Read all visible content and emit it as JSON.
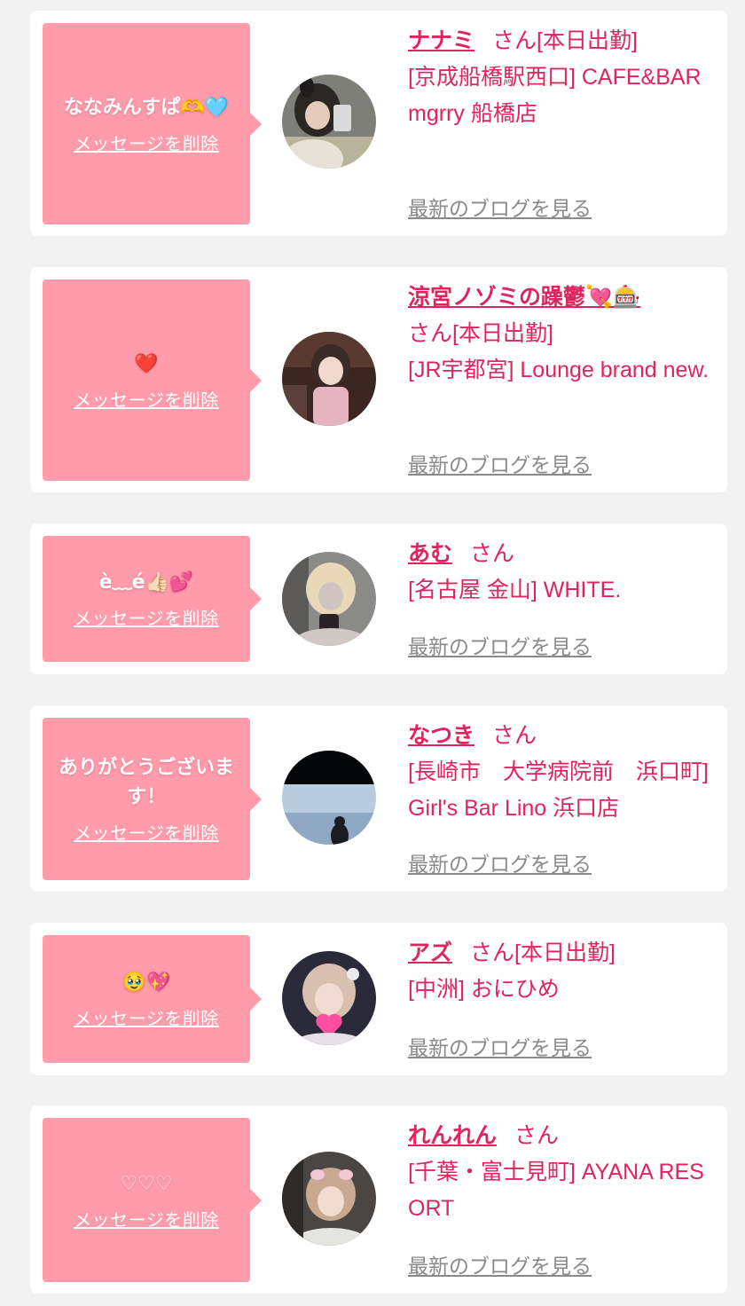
{
  "messages": [
    {
      "message": "ななみんすぱ🫶🩵",
      "delete_label": "メッセージを削除",
      "name": "ナナミ",
      "san": "さん",
      "status": "[本日出勤]",
      "shop": "[京成船橋駅西口] CAFE&BAR mgrry 船橋店",
      "blog_label": "最新のブログを見る"
    },
    {
      "message": "❤️",
      "delete_label": "メッセージを削除",
      "name": "涼宮ノゾミの躁鬱💘🎰",
      "san": "さん",
      "status": "[本日出勤]",
      "shop": "[JR宇都宮] Lounge brand new.",
      "blog_label": "最新のブログを見る"
    },
    {
      "message": "è﹏é👍🏻💕",
      "delete_label": "メッセージを削除",
      "name": "あむ",
      "san": "さん",
      "status": "",
      "shop": "[名古屋 金山] WHITE.",
      "blog_label": "最新のブログを見る"
    },
    {
      "message": "ありがとうございます！",
      "delete_label": "メッセージを削除",
      "name": "なつき",
      "san": "さん",
      "status": "",
      "shop": "[長崎市　大学病院前　浜口町] Girl's Bar Lino 浜口店",
      "blog_label": "最新のブログを見る"
    },
    {
      "message": "🥹💖",
      "delete_label": "メッセージを削除",
      "name": "アズ",
      "san": "さん",
      "status": "[本日出勤]",
      "shop": "[中洲] おにひめ",
      "blog_label": "最新のブログを見る"
    },
    {
      "message": "♡♡♡",
      "delete_label": "メッセージを削除",
      "name": "れんれん",
      "san": "さん",
      "status": "",
      "shop": "[千葉・富士見町] AYANA RESORT",
      "blog_label": "最新のブログを見る"
    }
  ],
  "colors": {
    "accent": "#e0245e",
    "bubble": "#ff9bab",
    "link_gray": "#8a8a8a",
    "background": "#f2f2f2"
  }
}
